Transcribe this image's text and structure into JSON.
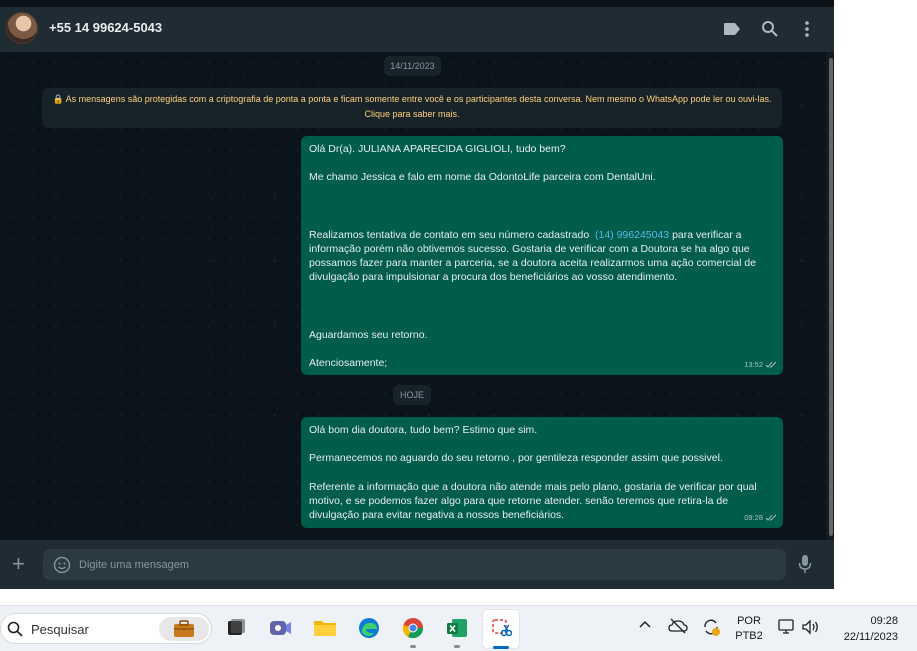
{
  "header": {
    "contact_name": "+55 14 99624-5043",
    "icons": [
      "label-icon",
      "search-icon",
      "menu-icon"
    ]
  },
  "chat": {
    "date_1": "14/11/2023",
    "encryption_notice": "🔒 As mensagens são protegidas com a criptografia de ponta a ponta e ficam somente entre você e os participantes desta conversa. Nem mesmo o WhatsApp pode ler ou ouvi-las. Clique para saber mais.",
    "message_1": {
      "greeting": "Olá Dr(a). JULIANA APARECIDA GIGLIOLI, tudo bem?",
      "intro": "Me chamo Jessica e falo em nome da OdontoLife parceira com DentalUni.",
      "body_before_link": "Realizamos tentativa de contato em seu número cadastrado  ",
      "phone_link": "(14) 996245043",
      "body_after_link": " para verificar a informação porém não obtivemos sucesso. Gostaria de verificar com a Doutora se ha algo que possamos fazer para manter a parceria, se a doutora aceita realizarmos uma ação comercial de divulgação para impulsionar a procura dos beneficiários ao vosso atendimento.",
      "closing_1": "Aguardamos seu retorno.",
      "closing_2": "Atenciosamente;",
      "time": "13:52"
    },
    "date_2": "HOJE",
    "message_2": {
      "line_1": "Olá bom dia doutora, tudo bem? Estimo que sim.",
      "line_2": "Permanecemos no aguardo do seu retorno , por gentileza responder assim que possivel.",
      "line_3": "Referente a informação que a doutora não atende mais pelo plano, gostaria de verificar por qual motivo, e se podemos fazer algo para que retorne atender. senão teremos que retira-la de divulgação para evitar negativa a nossos beneficiários.",
      "time": "09:28"
    }
  },
  "composer": {
    "placeholder": "Digite uma mensagem"
  },
  "taskbar": {
    "search_label": "Pesquisar",
    "language_1": "POR",
    "language_2": "PTB2",
    "time": "09:28",
    "date": "22/11/2023"
  },
  "colors": {
    "outgoing_bubble": "#005c4b",
    "chat_background": "#0b141a",
    "header_background": "#202c33",
    "encryption_text": "#ffd279",
    "link": "#53bdeb"
  }
}
